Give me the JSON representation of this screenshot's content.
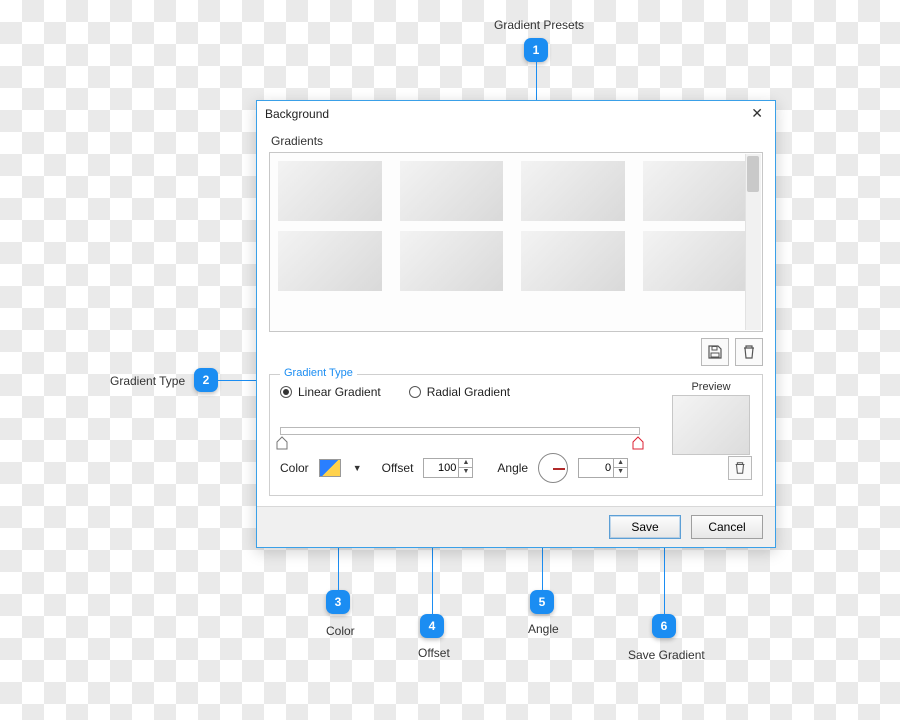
{
  "annotations": {
    "a1": {
      "num": "1",
      "label": "Gradient Presets"
    },
    "a2": {
      "num": "2",
      "label": "Gradient Type"
    },
    "a3": {
      "num": "3",
      "label": "Color"
    },
    "a4": {
      "num": "4",
      "label": "Offset"
    },
    "a5": {
      "num": "5",
      "label": "Angle"
    },
    "a6": {
      "num": "6",
      "label": "Save Gradient"
    }
  },
  "dialog": {
    "title": "Background",
    "sections": {
      "presets_label": "Gradients",
      "type_legend": "Gradient Type",
      "linear_label": "Linear Gradient",
      "radial_label": "Radial Gradient",
      "preview_label": "Preview",
      "color_label": "Color",
      "offset_label": "Offset",
      "angle_label": "Angle"
    },
    "values": {
      "offset": "100",
      "angle": "0"
    },
    "footer": {
      "save": "Save",
      "cancel": "Cancel"
    }
  }
}
